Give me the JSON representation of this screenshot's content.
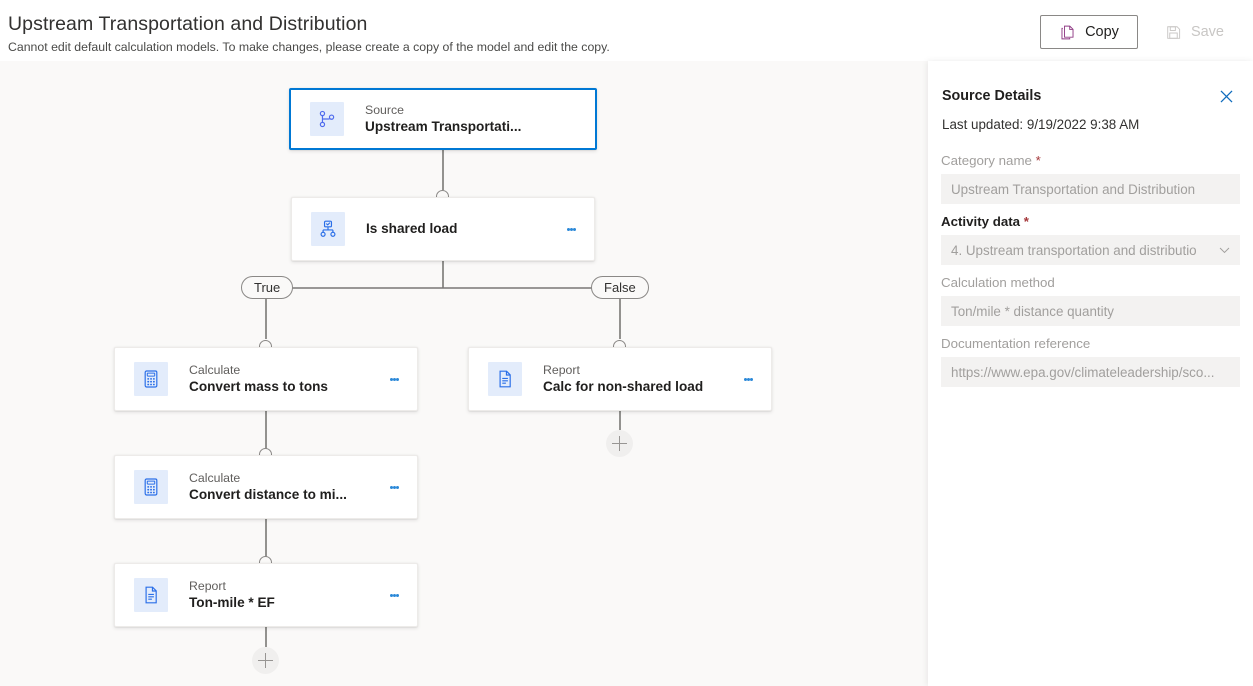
{
  "header": {
    "title": "Upstream Transportation and Distribution",
    "subtitle": "Cannot edit default calculation models. To make changes, please create a copy of the model and edit the copy.",
    "copy_label": "Copy",
    "save_label": "Save"
  },
  "colors": {
    "accent": "#0078d4",
    "node_icon_bg": "#e3ecfb",
    "canvas_bg": "#faf9f8",
    "copy_icon": "#8f3a84",
    "required_asterisk": "#a4373a"
  },
  "flow": {
    "nodes": [
      {
        "id": "source",
        "type": "Source",
        "name": "Upstream Transportati...",
        "icon": "branch-icon",
        "selected": true,
        "has_menu": false
      },
      {
        "id": "condition",
        "type": "",
        "name": "Is shared load",
        "icon": "condition-icon",
        "selected": false,
        "has_menu": true
      },
      {
        "id": "mass",
        "type": "Calculate",
        "name": "Convert mass to tons",
        "icon": "calculator-icon",
        "selected": false,
        "has_menu": true
      },
      {
        "id": "nonshared",
        "type": "Report",
        "name": "Calc for non-shared load",
        "icon": "document-icon",
        "selected": false,
        "has_menu": true
      },
      {
        "id": "distance",
        "type": "Calculate",
        "name": "Convert distance to mi...",
        "icon": "calculator-icon",
        "selected": false,
        "has_menu": true
      },
      {
        "id": "tonmile",
        "type": "Report",
        "name": "Ton-mile * EF",
        "icon": "document-icon",
        "selected": false,
        "has_menu": true
      }
    ],
    "branch_labels": {
      "true": "True",
      "false": "False"
    },
    "add_button_icon": "plus-icon"
  },
  "panel": {
    "title": "Source Details",
    "close_icon": "close-icon",
    "last_updated": "Last updated: 9/19/2022 9:38 AM",
    "fields": [
      {
        "label": "Category name",
        "required": true,
        "enabled": false,
        "value": "Upstream Transportation and Distribution",
        "control": "text"
      },
      {
        "label": "Activity data",
        "required": true,
        "enabled": true,
        "value": "4. Upstream transportation and distributio",
        "control": "dropdown"
      },
      {
        "label": "Calculation method",
        "required": false,
        "enabled": false,
        "value": "Ton/mile * distance quantity",
        "control": "text"
      },
      {
        "label": "Documentation reference",
        "required": false,
        "enabled": false,
        "value": "https://www.epa.gov/climateleadership/sco...",
        "control": "text"
      }
    ]
  }
}
